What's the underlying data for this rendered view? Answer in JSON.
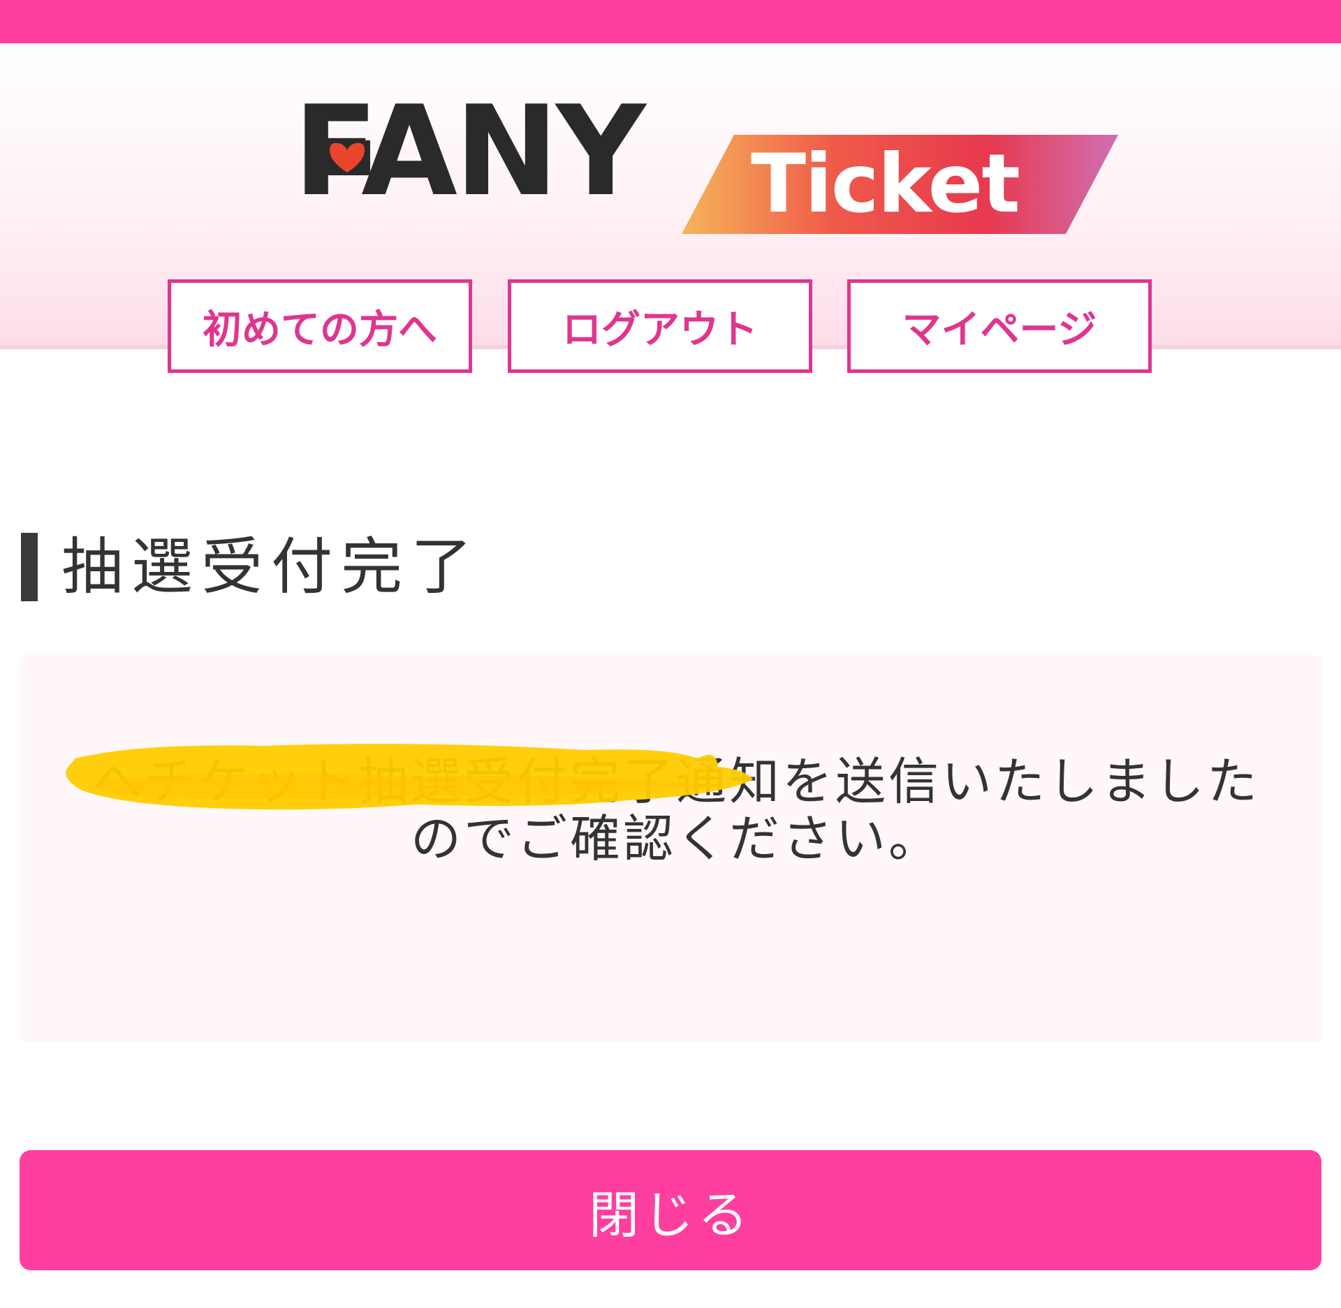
{
  "header": {
    "logo": {
      "brand": "FANY",
      "product": "Ticket"
    },
    "nav": [
      {
        "label": "初めての方へ"
      },
      {
        "label": "ログアウト"
      },
      {
        "label": "マイページ"
      }
    ]
  },
  "main": {
    "title": "抽選受付完了",
    "message": "へチケット抽選受付完了通知を送信いたしましたのでご確認ください。",
    "close_label": "閉じる"
  },
  "colors": {
    "accent": "#ff3fa0",
    "nav_border": "#e0358f",
    "message_bg": "#fff7f9",
    "redaction": "#ffcc00"
  }
}
